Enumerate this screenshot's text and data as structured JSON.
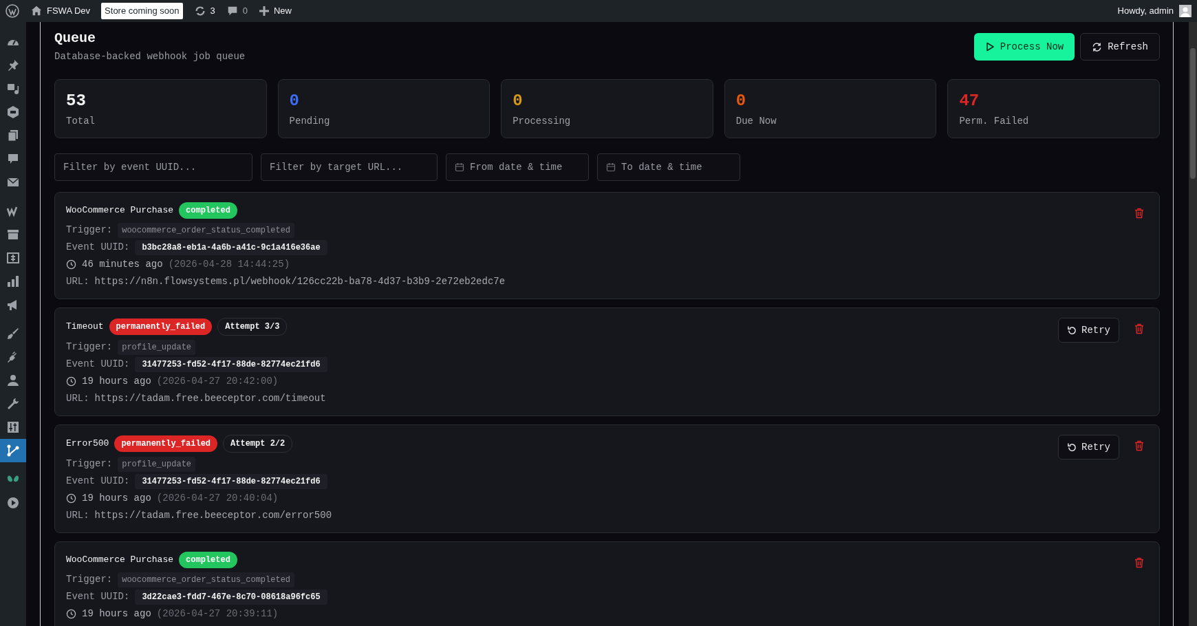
{
  "admin_bar": {
    "site_name": "FSWA Dev",
    "store_badge": "Store coming soon",
    "updates_count": "3",
    "comments_count": "0",
    "new_label": "New",
    "greeting": "Howdy, admin"
  },
  "sidebar": {
    "items": [
      {
        "selected": false
      },
      {
        "selected": false
      },
      {
        "selected": false
      },
      {
        "selected": false
      },
      {
        "selected": false
      },
      {
        "selected": false
      },
      {
        "selected": false
      },
      {
        "selected": false
      },
      {
        "selected": false
      },
      {
        "selected": false
      },
      {
        "selected": false
      },
      {
        "selected": false
      },
      {
        "selected": false
      },
      {
        "selected": false
      },
      {
        "selected": false
      },
      {
        "selected": false
      },
      {
        "selected": false
      },
      {
        "selected": true
      },
      {
        "selected": false
      },
      {
        "selected": false
      }
    ]
  },
  "header": {
    "title": "Queue",
    "subtitle": "Database-backed webhook job queue",
    "buttons": [
      {
        "kind": "primary",
        "label": "Process Now"
      },
      {
        "kind": "secondary",
        "label": "Refresh"
      }
    ]
  },
  "stats": [
    {
      "value": "53",
      "label": "Total",
      "color": "#f2f2f2"
    },
    {
      "value": "0",
      "label": "Pending",
      "color": "#3d6ef5"
    },
    {
      "value": "0",
      "label": "Processing",
      "color": "#d69a12"
    },
    {
      "value": "0",
      "label": "Due Now",
      "color": "#e8590c"
    },
    {
      "value": "47",
      "label": "Perm. Failed",
      "color": "#dc2626"
    }
  ],
  "filters": [
    {
      "kind": "text",
      "placeholder": "Filter by event UUID..."
    },
    {
      "kind": "text",
      "placeholder": "Filter by target URL..."
    },
    {
      "kind": "date",
      "placeholder": "From date & time"
    },
    {
      "kind": "date",
      "placeholder": "To date & time"
    }
  ],
  "jobs": [
    {
      "name": "WooCommerce Purchase",
      "status": {
        "kind": "completed",
        "label": "completed"
      },
      "trigger_label": "Trigger:",
      "trigger": "woocommerce_order_status_completed",
      "uuid_label": "Event UUID:",
      "uuid": "b3bc28a8-eb1a-4a6b-a41c-9c1a416e36ae",
      "time_ago": "46 minutes ago",
      "timestamp": "(2026-04-28 14:44:25)",
      "url_label": "URL:",
      "url": "https://n8n.flowsystems.pl/webhook/126cc22b-ba78-4d37-b3b9-2e72eb2edc7e"
    },
    {
      "name": "Timeout",
      "status": {
        "kind": "failed",
        "label": "permanently_failed"
      },
      "attempt": "Attempt 3/3",
      "retry": "Retry",
      "trigger_label": "Trigger:",
      "trigger": "profile_update",
      "uuid_label": "Event UUID:",
      "uuid": "31477253-fd52-4f17-88de-82774ec21fd6",
      "time_ago": "19 hours ago",
      "timestamp": "(2026-04-27 20:42:00)",
      "url_label": "URL:",
      "url": "https://tadam.free.beeceptor.com/timeout"
    },
    {
      "name": "Error500",
      "status": {
        "kind": "failed",
        "label": "permanently_failed"
      },
      "attempt": "Attempt 2/2",
      "retry": "Retry",
      "trigger_label": "Trigger:",
      "trigger": "profile_update",
      "uuid_label": "Event UUID:",
      "uuid": "31477253-fd52-4f17-88de-82774ec21fd6",
      "time_ago": "19 hours ago",
      "timestamp": "(2026-04-27 20:40:04)",
      "url_label": "URL:",
      "url": "https://tadam.free.beeceptor.com/error500"
    },
    {
      "name": "WooCommerce Purchase",
      "status": {
        "kind": "completed",
        "label": "completed"
      },
      "trigger_label": "Trigger:",
      "trigger": "woocommerce_order_status_completed",
      "uuid_label": "Event UUID:",
      "uuid": "3d22cae3-fdd7-467e-8c70-08618a96fc65",
      "time_ago": "19 hours ago",
      "timestamp": "(2026-04-27 20:39:11)"
    }
  ]
}
